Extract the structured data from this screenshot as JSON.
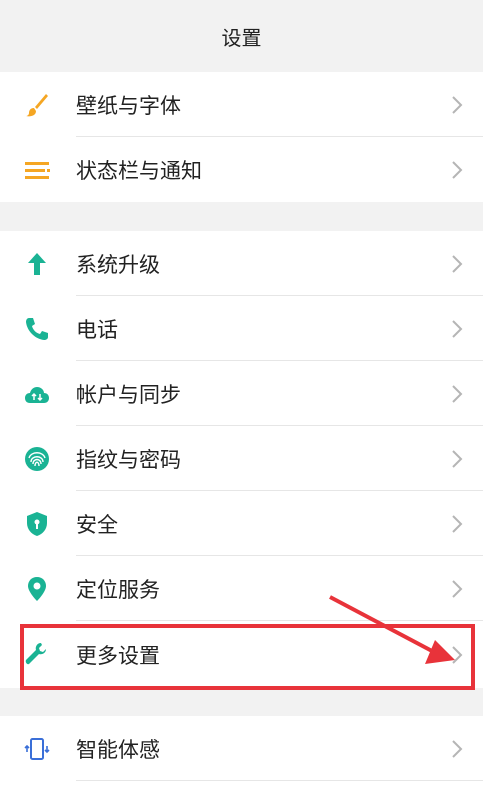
{
  "header": {
    "title": "设置"
  },
  "sections": [
    {
      "items": [
        {
          "label": "壁纸与字体",
          "icon": "paintbrush-icon",
          "color": "#f5a623"
        },
        {
          "label": "状态栏与通知",
          "icon": "list-lines-icon",
          "color": "#f5a623"
        }
      ]
    },
    {
      "items": [
        {
          "label": "系统升级",
          "icon": "arrow-up-icon",
          "color": "#1ab394"
        },
        {
          "label": "电话",
          "icon": "phone-icon",
          "color": "#1ab394"
        },
        {
          "label": "帐户与同步",
          "icon": "cloud-sync-icon",
          "color": "#1ab394"
        },
        {
          "label": "指纹与密码",
          "icon": "fingerprint-icon",
          "color": "#1ab394"
        },
        {
          "label": "安全",
          "icon": "shield-icon",
          "color": "#1ab394"
        },
        {
          "label": "定位服务",
          "icon": "location-pin-icon",
          "color": "#1ab394"
        },
        {
          "label": "更多设置",
          "icon": "wrench-icon",
          "color": "#1ab394",
          "highlighted": true
        }
      ]
    },
    {
      "items": [
        {
          "label": "智能体感",
          "icon": "phone-motion-icon",
          "color": "#3a6fd8"
        }
      ]
    }
  ],
  "annotation": {
    "highlight_color": "#e8333a"
  }
}
